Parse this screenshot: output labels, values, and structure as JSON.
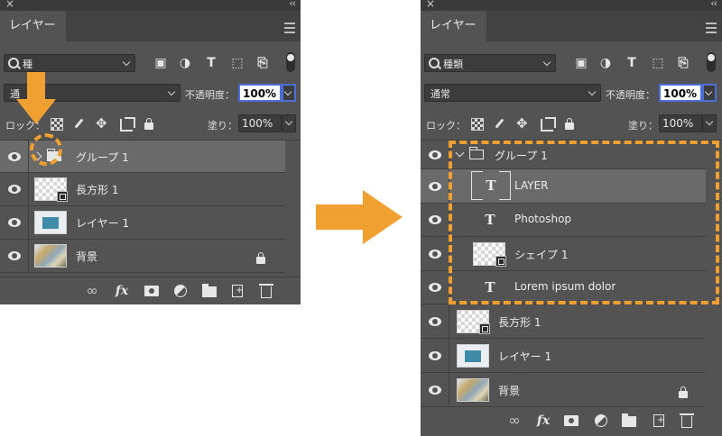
{
  "panel_title": "レイヤー",
  "close_glyph": "×",
  "collapse_glyph": "‹‹",
  "left": {
    "filter": {
      "label": "種"
    },
    "blend": {
      "label": "通"
    },
    "opacity_label": "不透明度：",
    "opacity_value": "100%",
    "lock_label": "ロック：",
    "fill_label": "塗り：",
    "fill_value": "100%",
    "layers": [
      {
        "name": "グループ 1",
        "type": "group-collapsed"
      },
      {
        "name": "長方形 1",
        "type": "shape"
      },
      {
        "name": "レイヤー 1",
        "type": "pixel"
      },
      {
        "name": "背景",
        "type": "background",
        "locked": true
      }
    ]
  },
  "right": {
    "filter": {
      "label": "種類"
    },
    "blend": {
      "label": "通常"
    },
    "opacity_label": "不透明度：",
    "opacity_value": "100%",
    "lock_label": "ロック：",
    "fill_label": "塗り：",
    "fill_value": "100%",
    "layers": [
      {
        "name": "グループ 1",
        "type": "group-expanded"
      },
      {
        "name": "LAYER",
        "type": "text-selected"
      },
      {
        "name": "Photoshop",
        "type": "text"
      },
      {
        "name": "シェイプ 1",
        "type": "shape"
      },
      {
        "name": "Lorem ipsum dolor",
        "type": "text"
      },
      {
        "name": "長方形 1",
        "type": "shape"
      },
      {
        "name": "レイヤー 1",
        "type": "pixel"
      },
      {
        "name": "背景",
        "type": "background",
        "locked": true
      }
    ]
  },
  "filter_icons": [
    "image-filter-icon",
    "adjustment-filter-icon",
    "type-filter-icon",
    "shape-filter-icon",
    "smart-object-filter-icon"
  ],
  "type_glyph": "T",
  "fx_glyph": "fx",
  "accent_color": "#f0a030",
  "panel_bg": "#535353",
  "selection_outline": "#4b6fd6"
}
